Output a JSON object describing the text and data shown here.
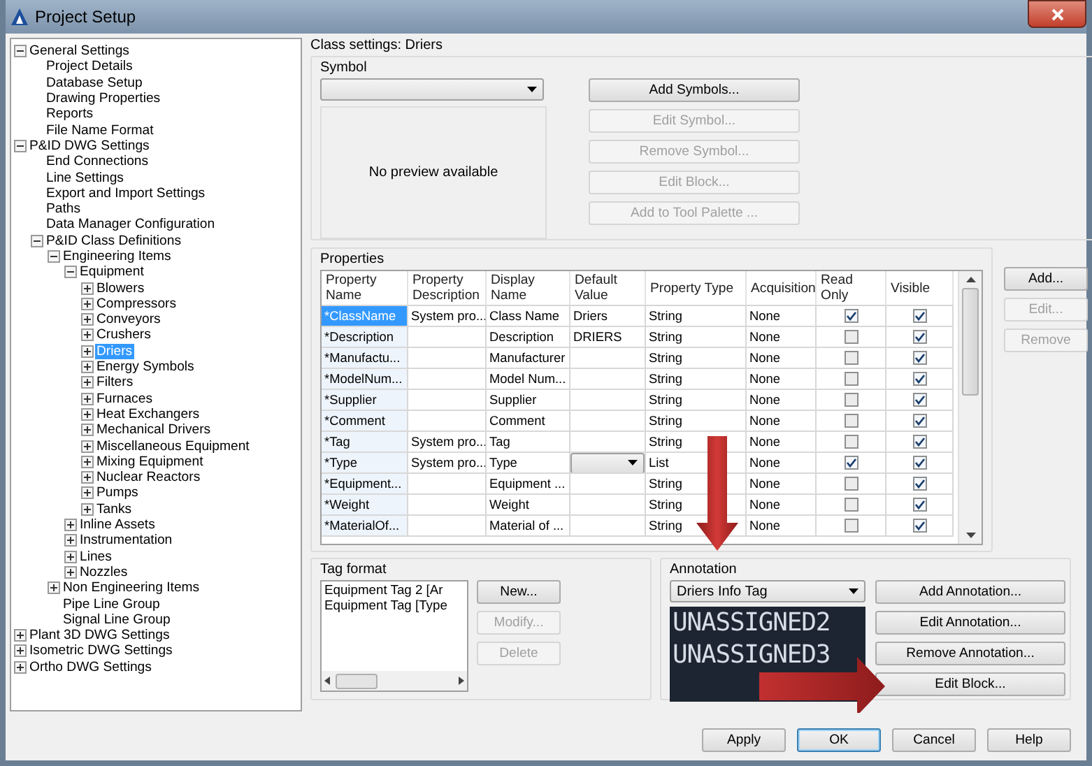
{
  "window": {
    "title": "Project Setup"
  },
  "tree": [
    {
      "label": "General Settings",
      "expanded": true,
      "selected": false,
      "children": [
        {
          "label": "Project Details",
          "selected": false
        },
        {
          "label": "Database Setup",
          "selected": false
        },
        {
          "label": "Drawing Properties",
          "selected": false
        },
        {
          "label": "Reports",
          "selected": false
        },
        {
          "label": "File Name Format",
          "selected": false
        }
      ]
    },
    {
      "label": "P&ID DWG Settings",
      "expanded": true,
      "selected": false,
      "children": [
        {
          "label": "End Connections",
          "selected": false
        },
        {
          "label": "Line Settings",
          "selected": false
        },
        {
          "label": "Export and Import Settings",
          "selected": false
        },
        {
          "label": "Paths",
          "selected": false
        },
        {
          "label": "Data Manager Configuration",
          "selected": false
        },
        {
          "label": "P&ID Class Definitions",
          "expanded": true,
          "selected": false,
          "children": [
            {
              "label": "Engineering Items",
              "expanded": true,
              "selected": false,
              "children": [
                {
                  "label": "Equipment",
                  "expanded": true,
                  "selected": false,
                  "children": [
                    {
                      "label": "Blowers",
                      "expanded": false,
                      "selected": false
                    },
                    {
                      "label": "Compressors",
                      "expanded": false,
                      "selected": false
                    },
                    {
                      "label": "Conveyors",
                      "expanded": false,
                      "selected": false
                    },
                    {
                      "label": "Crushers",
                      "expanded": false,
                      "selected": false
                    },
                    {
                      "label": "Driers",
                      "expanded": false,
                      "selected": true
                    },
                    {
                      "label": "Energy Symbols",
                      "expanded": false,
                      "selected": false
                    },
                    {
                      "label": "Filters",
                      "expanded": false,
                      "selected": false
                    },
                    {
                      "label": "Furnaces",
                      "expanded": false,
                      "selected": false
                    },
                    {
                      "label": "Heat Exchangers",
                      "expanded": false,
                      "selected": false
                    },
                    {
                      "label": "Mechanical Drivers",
                      "expanded": false,
                      "selected": false
                    },
                    {
                      "label": "Miscellaneous Equipment",
                      "expanded": false,
                      "selected": false
                    },
                    {
                      "label": "Mixing Equipment",
                      "expanded": false,
                      "selected": false
                    },
                    {
                      "label": "Nuclear Reactors",
                      "expanded": false,
                      "selected": false
                    },
                    {
                      "label": "Pumps",
                      "expanded": false,
                      "selected": false
                    },
                    {
                      "label": "Tanks",
                      "expanded": false,
                      "selected": false
                    }
                  ]
                },
                {
                  "label": "Inline Assets",
                  "expanded": false,
                  "selected": false
                },
                {
                  "label": "Instrumentation",
                  "expanded": false,
                  "selected": false
                },
                {
                  "label": "Lines",
                  "expanded": false,
                  "selected": false
                },
                {
                  "label": "Nozzles",
                  "expanded": false,
                  "selected": false
                }
              ]
            },
            {
              "label": "Non Engineering Items",
              "expanded": false,
              "selected": false
            },
            {
              "label": "Pipe Line Group",
              "selected": false
            },
            {
              "label": "Signal Line Group",
              "selected": false
            }
          ]
        }
      ]
    },
    {
      "label": "Plant 3D DWG Settings",
      "expanded": false,
      "selected": false
    },
    {
      "label": "Isometric DWG Settings",
      "expanded": false,
      "selected": false
    },
    {
      "label": "Ortho DWG Settings",
      "expanded": false,
      "selected": false
    }
  ],
  "class_settings": "Class settings: Driers",
  "symbol": {
    "title": "Symbol",
    "preview": "No preview available",
    "buttons": [
      {
        "label": "Add Symbols...",
        "disabled": false
      },
      {
        "label": "Edit Symbol...",
        "disabled": true
      },
      {
        "label": "Remove Symbol...",
        "disabled": true
      },
      {
        "label": "Edit Block...",
        "disabled": true
      },
      {
        "label": "Add to Tool Palette ...",
        "disabled": true
      }
    ]
  },
  "properties": {
    "title": "Properties",
    "columns": [
      "Property Name",
      "Property Description",
      "Display Name",
      "Default Value",
      "Property Type",
      "Acquisition",
      "Read Only",
      "Visible"
    ],
    "rows": [
      {
        "name": "*ClassName",
        "description": "System pro...",
        "display": "Class Name",
        "default": "Driers",
        "type": "String",
        "acquisition": "None",
        "read_only": true,
        "visible": true,
        "selected": true
      },
      {
        "name": "*Description",
        "display": "Description",
        "default": "DRIERS",
        "type": "String",
        "acquisition": "None",
        "read_only": false,
        "visible": true,
        "selected": false
      },
      {
        "name": "*Manufactu...",
        "display": "Manufacturer",
        "type": "String",
        "acquisition": "None",
        "read_only": false,
        "visible": true,
        "selected": false
      },
      {
        "name": "*ModelNum...",
        "display": "Model Num...",
        "type": "String",
        "acquisition": "None",
        "read_only": false,
        "visible": true,
        "selected": false
      },
      {
        "name": "*Supplier",
        "display": "Supplier",
        "type": "String",
        "acquisition": "None",
        "read_only": false,
        "visible": true,
        "selected": false
      },
      {
        "name": "*Comment",
        "display": "Comment",
        "type": "String",
        "acquisition": "None",
        "read_only": false,
        "visible": true,
        "selected": false
      },
      {
        "name": "*Tag",
        "description": "System pro...",
        "display": "Tag",
        "type": "String",
        "acquisition": "None",
        "read_only": false,
        "visible": true,
        "selected": false
      },
      {
        "name": "*Type",
        "description": "System pro...",
        "display": "Type",
        "kind": "list",
        "type": "List",
        "acquisition": "None",
        "read_only": true,
        "visible": true,
        "selected": false
      },
      {
        "name": "*Equipment...",
        "display": "Equipment ...",
        "type": "String",
        "acquisition": "None",
        "read_only": false,
        "visible": true,
        "selected": false
      },
      {
        "name": "*Weight",
        "display": "Weight",
        "type": "String",
        "acquisition": "None",
        "read_only": false,
        "visible": true,
        "selected": false
      },
      {
        "name": "*MaterialOf...",
        "display": "Material of ...",
        "type": "String",
        "acquisition": "None",
        "read_only": false,
        "visible": true,
        "selected": false
      }
    ],
    "buttons": [
      {
        "label": "Add...",
        "disabled": false
      },
      {
        "label": "Edit...",
        "disabled": true
      },
      {
        "label": "Remove",
        "disabled": true
      }
    ]
  },
  "tag_format": {
    "title": "Tag format",
    "items": [
      "Equipment Tag 2 [Ar",
      "Equipment Tag [Type"
    ],
    "buttons": [
      {
        "label": "New...",
        "disabled": false
      },
      {
        "label": "Modify...",
        "disabled": true
      },
      {
        "label": "Delete",
        "disabled": true
      }
    ]
  },
  "annotation": {
    "title": "Annotation",
    "selected_value": "Driers Info Tag",
    "preview_lines": [
      "UNASSIGNED2",
      "UNASSIGNED3"
    ],
    "buttons": [
      {
        "label": "Add Annotation...",
        "disabled": false
      },
      {
        "label": "Edit Annotation...",
        "disabled": false
      },
      {
        "label": "Remove Annotation...",
        "disabled": false
      },
      {
        "label": "Edit Block...",
        "disabled": false
      }
    ]
  },
  "dialog_buttons": [
    {
      "label": "Apply",
      "default": false
    },
    {
      "label": "OK",
      "default": true
    },
    {
      "label": "Cancel",
      "default": false
    },
    {
      "label": "Help",
      "default": false
    }
  ]
}
